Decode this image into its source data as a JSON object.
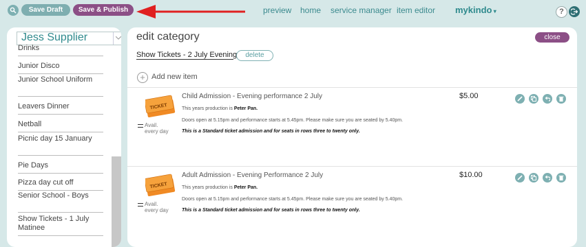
{
  "topbar": {
    "save_draft": "Save Draft",
    "save_publish": "Save & Publish",
    "nav": [
      "preview",
      "home",
      "service manager",
      "item editor"
    ],
    "brand": "mykindo",
    "help": "?"
  },
  "sidebar": {
    "supplier": "Jess Supplier",
    "items": [
      "Drinks",
      "Junior Disco",
      "Junior School Uniform",
      "Leavers Dinner",
      "Netball",
      "Picnic day 15 January",
      "Pie Days",
      "Pizza day cut off",
      "Senior School - Boys",
      "Show Tickets - 1 July Matinee"
    ]
  },
  "main": {
    "title": "edit category",
    "close": "close",
    "category_name": "Show Tickets - 2 July Evening",
    "delete": "delete",
    "add_item": "Add new item",
    "items": [
      {
        "title": "Child Admission - Evening performance 2 July",
        "line1_prefix": "This years production is ",
        "line1_bold": "Peter Pan.",
        "line2": "Doors open at 5.15pm and performance starts at 5.45pm. Please make sure you are seated by 5.40pm.",
        "line3": "This is a Standard ticket admission and for seats in rows three to twenty only.",
        "price": "$5.00",
        "availability": "Avail. every day"
      },
      {
        "title": "Adult Admission - Evening Performance 2 July",
        "line1_prefix": "This years production is ",
        "line1_bold": "Peter Pan.",
        "line2": "Doors open at 5.15pm and performance starts at 5.45pm. Please make sure you are seated by 5.40pm.",
        "line3": "This is a Standard ticket admission and for seats in rows three to twenty only.",
        "price": "$10.00",
        "availability": "Avail. every day"
      }
    ],
    "ticket_label": "TICKET"
  },
  "colors": {
    "background": "#d6e8e8",
    "accent_teal": "#7eb0b2",
    "accent_purple": "#8c4f86",
    "link": "#3b8a8e",
    "ticket_orange": "#f08a24",
    "arrow_red": "#e02020"
  }
}
